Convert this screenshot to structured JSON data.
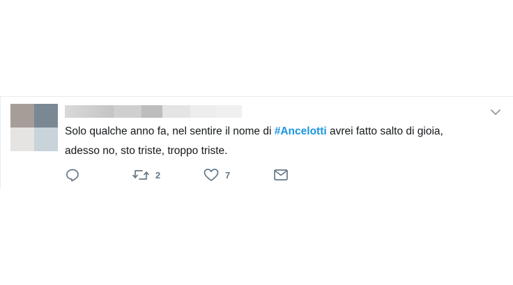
{
  "tweet": {
    "text_before": "Solo qualche anno fa, nel sentire il nome di ",
    "hashtag": "#Ancelotti",
    "text_after": " avrei fatto salto di gioia,\nadesso no, sto triste, troppo triste.",
    "retweet_count": "2",
    "like_count": "7"
  },
  "icons": {
    "reply": "reply-icon",
    "retweet": "retweet-icon",
    "like": "heart-icon",
    "message": "envelope-icon",
    "menu": "chevron-down-icon"
  },
  "colors": {
    "hashtag": "#1b95e0",
    "action_icon": "#657786",
    "text": "#14171a",
    "border": "#e6ecf0"
  }
}
